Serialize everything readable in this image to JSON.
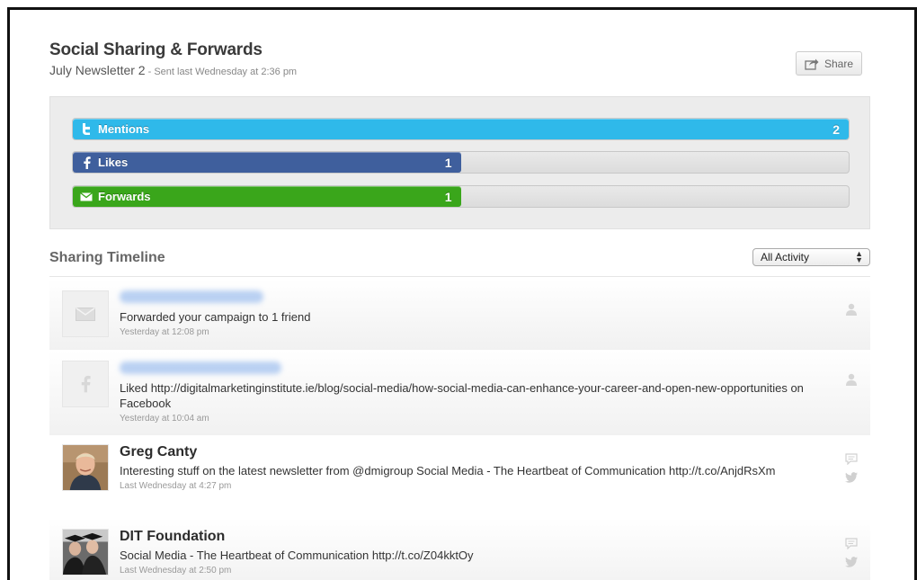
{
  "header": {
    "title": "Social Sharing & Forwards",
    "campaign_name": "July Newsletter 2",
    "sent_info": "- Sent last Wednesday at 2:36 pm",
    "share_label": "Share"
  },
  "stats": {
    "bars": [
      {
        "name": "Mentions",
        "icon": "twitter-icon",
        "count": "2",
        "fraction": 1.0,
        "color": "#2fb9ea"
      },
      {
        "name": "Likes",
        "icon": "facebook-icon",
        "count": "1",
        "fraction": 0.5,
        "color": "#3f5f9d"
      },
      {
        "name": "Forwards",
        "icon": "envelope-icon",
        "count": "1",
        "fraction": 0.5,
        "color": "#3aa61b"
      }
    ]
  },
  "timeline": {
    "title": "Sharing Timeline",
    "filter_value": "All Activity",
    "items": [
      {
        "avatar": "envelope-icon",
        "name": "",
        "text": "Forwarded your campaign to 1 friend",
        "time": "Yesterday at 12:08 pm"
      },
      {
        "avatar": "facebook-icon",
        "name": "",
        "text": "Liked http://digitalmarketinginstitute.ie/blog/social-media/how-social-media-can-enhance-your-career-and-open-new-opportunities on Facebook",
        "time": "Yesterday at 10:04 am"
      },
      {
        "avatar": "user-photo",
        "name": "Greg Canty",
        "text": "Interesting stuff on the latest newsletter from @dmigroup Social Media - The Heartbeat of Communication http://t.co/AnjdRsXm",
        "time": "Last Wednesday at 4:27 pm"
      },
      {
        "avatar": "group-photo",
        "name": "DIT Foundation",
        "text": "Social Media - The Heartbeat of Communication http://t.co/Z04kktOy",
        "time": "Last Wednesday at 2:50 pm"
      }
    ]
  }
}
